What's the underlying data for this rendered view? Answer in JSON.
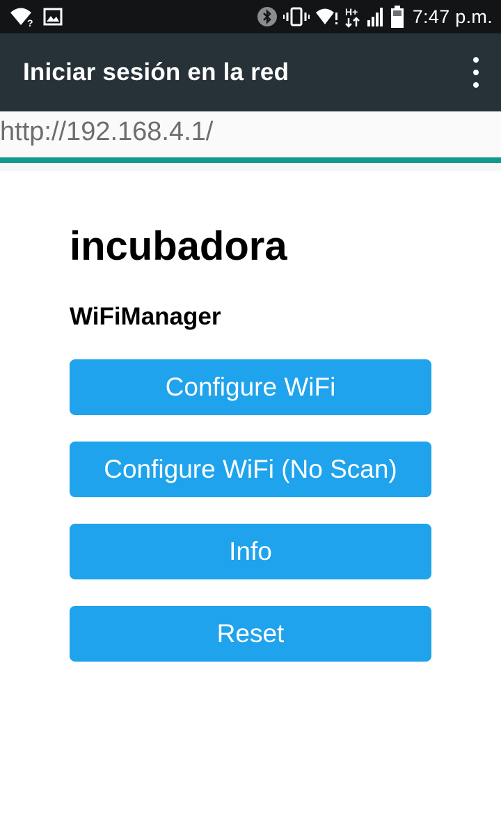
{
  "status_bar": {
    "time": "7:47 p.m.",
    "icons": [
      "wifi-question-icon",
      "image-notification-icon",
      "bluetooth-icon",
      "vibrate-icon",
      "wifi-alert-icon",
      "hplus-data-icon",
      "signal-icon",
      "battery-icon"
    ],
    "data_label": "H+"
  },
  "app_bar": {
    "title": "Iniciar sesión en la red",
    "menu_icon": "more-vertical-icon"
  },
  "url_bar": {
    "url": "http://192.168.4.1/"
  },
  "progress": {
    "value": 1.0,
    "color": "#139a8a"
  },
  "page": {
    "title": "incubadora",
    "subtitle": "WiFiManager",
    "buttons": [
      {
        "label": "Configure WiFi"
      },
      {
        "label": "Configure WiFi (No Scan)"
      },
      {
        "label": "Info"
      },
      {
        "label": "Reset"
      }
    ]
  },
  "colors": {
    "status_bar": "#121416",
    "app_bar": "#263238",
    "button": "#1fa3ec",
    "accent": "#139a8a"
  }
}
